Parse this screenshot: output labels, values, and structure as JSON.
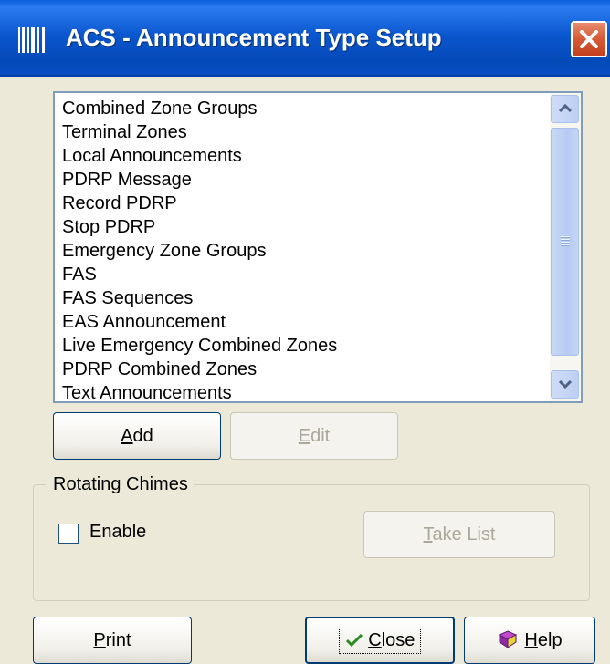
{
  "window": {
    "title": "ACS - Announcement Type Setup",
    "app_icon": "barcode-icon",
    "close_icon": "close-icon"
  },
  "announcement_types": {
    "items": [
      "Combined Zone Groups",
      "Terminal Zones",
      "Local Announcements",
      "PDRP Message",
      "Record PDRP",
      "Stop PDRP",
      "Emergency Zone Groups",
      "FAS",
      "FAS Sequences",
      "EAS Announcement",
      "Live Emergency Combined Zones",
      "PDRP Combined Zones",
      "Text Announcements"
    ]
  },
  "buttons": {
    "add": {
      "mnemonic": "A",
      "rest": "dd"
    },
    "edit": {
      "mnemonic": "E",
      "rest": "dit",
      "enabled": false
    },
    "take_list": {
      "mnemonic": "T",
      "rest": "ake List",
      "enabled": false
    },
    "print": {
      "mnemonic": "P",
      "rest": "rint"
    },
    "close": {
      "mnemonic": "C",
      "rest": "lose",
      "icon": "checkmark-icon"
    },
    "help": {
      "mnemonic": "H",
      "rest": "elp",
      "icon": "help-book-icon"
    }
  },
  "rotating_chimes": {
    "group_label": "Rotating Chimes",
    "enable_label": "Enable",
    "enabled": false
  },
  "colors": {
    "titlebar": "#0b57cf",
    "close_button": "#d45a36",
    "dialog_bg": "#ece9d8",
    "disabled_text": "#aca899"
  }
}
